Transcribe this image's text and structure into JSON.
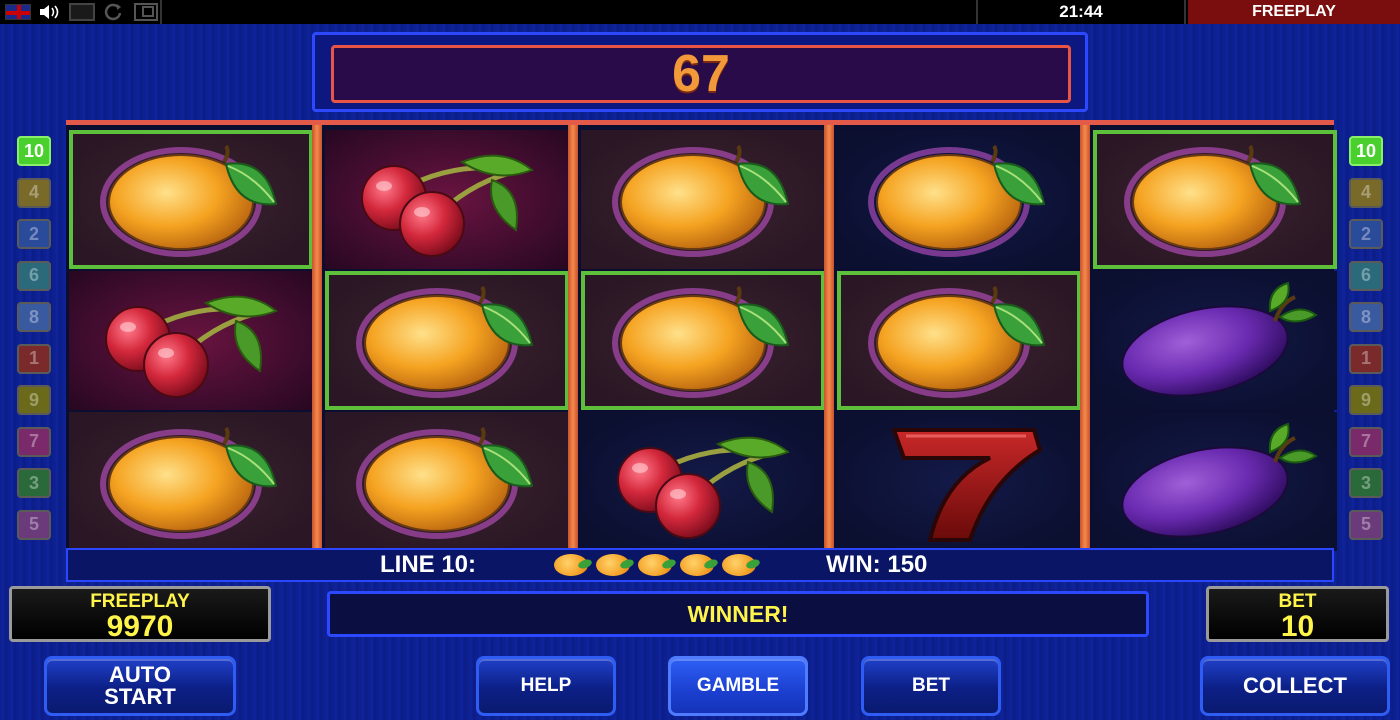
{
  "topbar": {
    "flag_icon": "uk-flag-icon",
    "sound_icon": "speaker-icon",
    "clock": "21:44",
    "mode": "FREEPLAY"
  },
  "win_display": {
    "value": "67"
  },
  "lines_left": [
    "10",
    "4",
    "2",
    "6",
    "8",
    "1",
    "9",
    "7",
    "3",
    "5"
  ],
  "lines_right": [
    "10",
    "4",
    "2",
    "6",
    "8",
    "1",
    "9",
    "7",
    "3",
    "5"
  ],
  "line_colors": {
    "10": "#4ad02e",
    "4": "#7a6a2a",
    "2": "#2a4a9a",
    "6": "#2a6a7a",
    "8": "#3a5aa0",
    "1": "#7a2a2a",
    "9": "#6a6a1a",
    "7": "#7a2a6a",
    "3": "#2a6a3a",
    "5": "#6a3a7a"
  },
  "reels": [
    [
      {
        "symbol": "orange",
        "bg": "brown",
        "win": true
      },
      {
        "symbol": "cherry",
        "bg": "red",
        "win": false
      },
      {
        "symbol": "orange",
        "bg": "brown",
        "win": false
      }
    ],
    [
      {
        "symbol": "cherry",
        "bg": "red",
        "win": false
      },
      {
        "symbol": "orange",
        "bg": "brown",
        "win": true
      },
      {
        "symbol": "orange",
        "bg": "brown",
        "win": false
      }
    ],
    [
      {
        "symbol": "orange",
        "bg": "brown",
        "win": false
      },
      {
        "symbol": "orange",
        "bg": "brown",
        "win": true
      },
      {
        "symbol": "cherry",
        "bg": "navy",
        "win": false
      }
    ],
    [
      {
        "symbol": "orange",
        "bg": "navy",
        "win": false
      },
      {
        "symbol": "orange",
        "bg": "brown",
        "win": true
      },
      {
        "symbol": "seven",
        "bg": "navy",
        "win": false
      }
    ],
    [
      {
        "symbol": "orange",
        "bg": "brown",
        "win": true
      },
      {
        "symbol": "plum",
        "bg": "navy",
        "win": false
      },
      {
        "symbol": "plum",
        "bg": "navy",
        "win": false
      }
    ]
  ],
  "line_info": {
    "line_label": "LINE 10:",
    "symbols_count": 5,
    "win_label": "WIN: 150"
  },
  "balance": {
    "label": "FREEPLAY",
    "value": "9970"
  },
  "message": "WINNER!",
  "bet": {
    "label": "BET",
    "value": "10"
  },
  "buttons": {
    "auto_start": "AUTO\nSTART",
    "help": "HELP",
    "gamble": "GAMBLE",
    "bet": "BET",
    "collect": "COLLECT"
  }
}
